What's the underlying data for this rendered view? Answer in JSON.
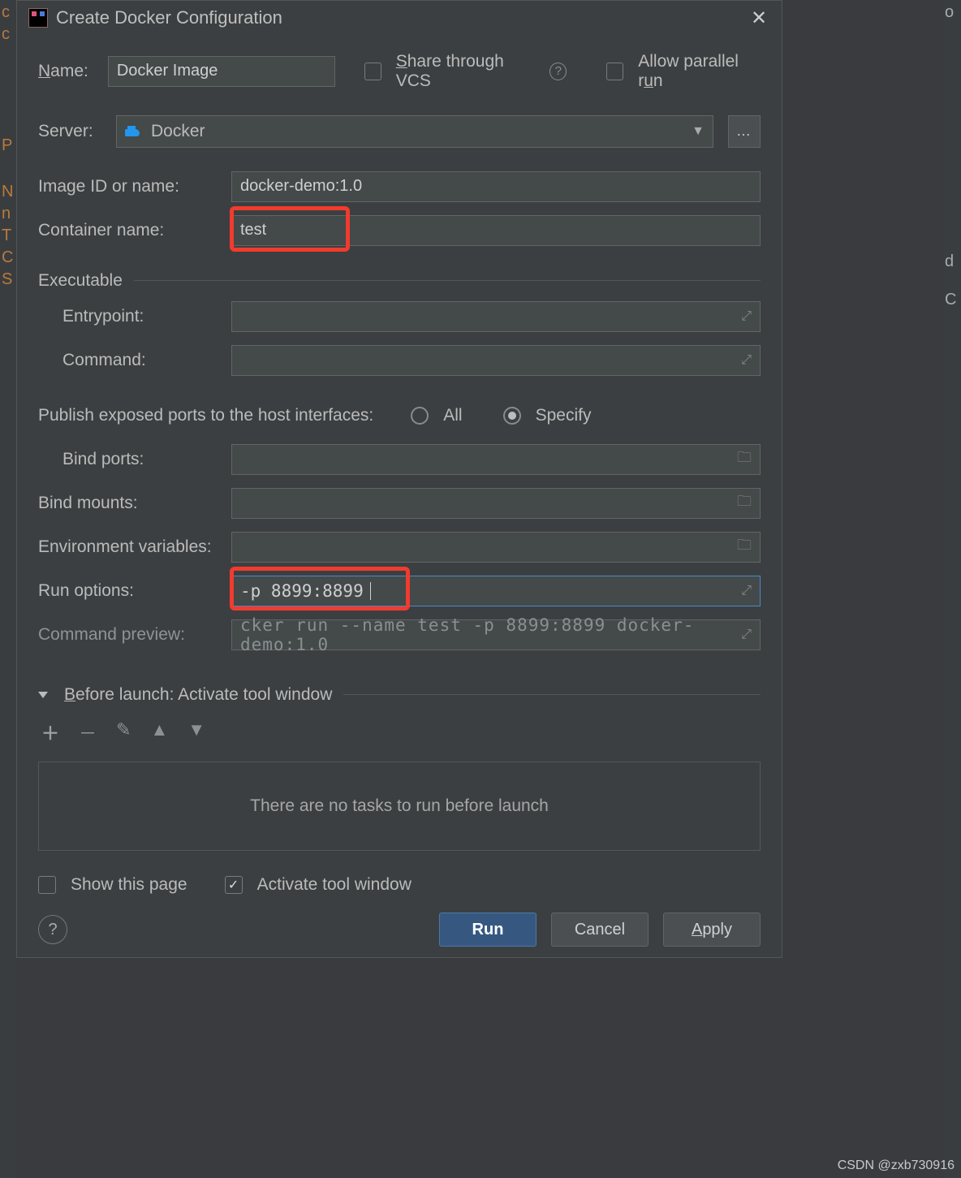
{
  "title": "Create Docker Configuration",
  "gutter_left": [
    "c",
    "c",
    "",
    "",
    "",
    "",
    "P",
    "",
    "N",
    "n",
    "T",
    "C",
    "S"
  ],
  "gutter_right": [
    "o",
    "",
    "",
    "",
    "",
    "",
    "",
    "",
    "",
    "d",
    "",
    "C",
    ""
  ],
  "fields": {
    "name_label": "Name:",
    "name_value": "Docker Image",
    "share_label": "Share through VCS",
    "allow_parallel_label": "Allow parallel run",
    "server_label": "Server:",
    "server_value": "Docker",
    "image_label": "Image ID or name:",
    "image_value": "docker-demo:1.0",
    "container_label": "Container name:",
    "container_value": "test",
    "executable_header": "Executable",
    "entrypoint_label": "Entrypoint:",
    "entrypoint_value": "",
    "command_label": "Command:",
    "command_value": "",
    "publish_label": "Publish exposed ports to the host interfaces:",
    "publish_all": "All",
    "publish_specify": "Specify",
    "bind_ports_label": "Bind ports:",
    "bind_mounts_label": "Bind mounts:",
    "env_label": "Environment variables:",
    "run_options_label": "Run options:",
    "run_options_value": "-p 8899:8899",
    "preview_label": "Command preview:",
    "preview_value": "cker run --name test -p 8899:8899 docker-demo:1.0",
    "before_launch_header": "Before launch: Activate tool window",
    "no_tasks": "There are no tasks to run before launch",
    "show_page": "Show this page",
    "activate_tool": "Activate tool window"
  },
  "buttons": {
    "run": "Run",
    "cancel": "Cancel",
    "apply": "Apply"
  },
  "watermark": "CSDN @zxb730916"
}
